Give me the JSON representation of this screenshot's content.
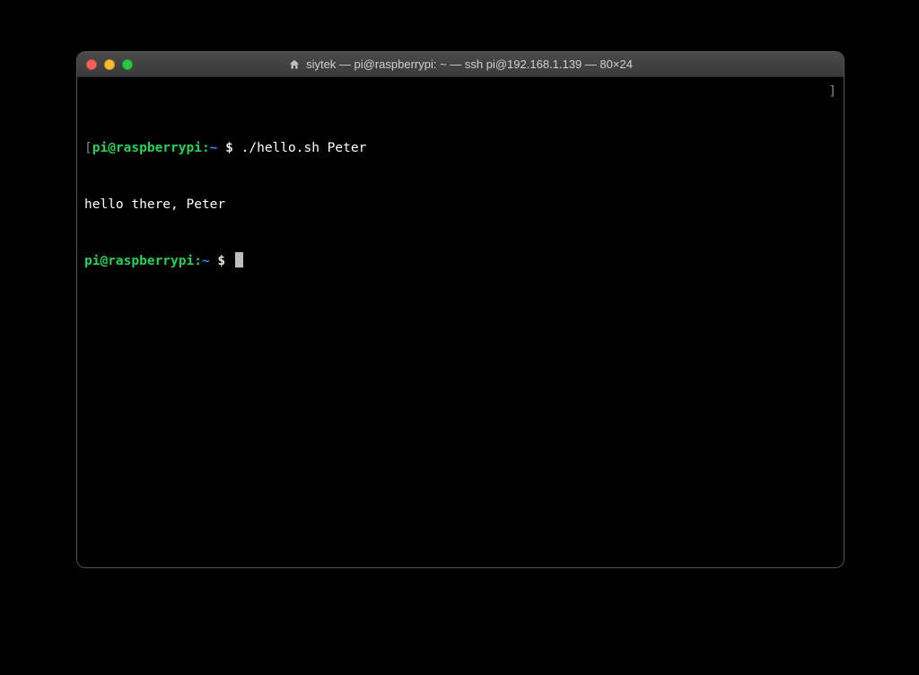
{
  "window": {
    "title": "siytek — pi@raspberrypi: ~ — ssh pi@192.168.1.139 — 80×24"
  },
  "prompt": {
    "open_bracket": "[",
    "close_bracket": "]",
    "userhost": "pi@raspberrypi",
    "colon": ":",
    "path": "~",
    "dollar": " $ "
  },
  "lines": {
    "cmd1": "./hello.sh Peter",
    "out1": "hello there, Peter"
  }
}
